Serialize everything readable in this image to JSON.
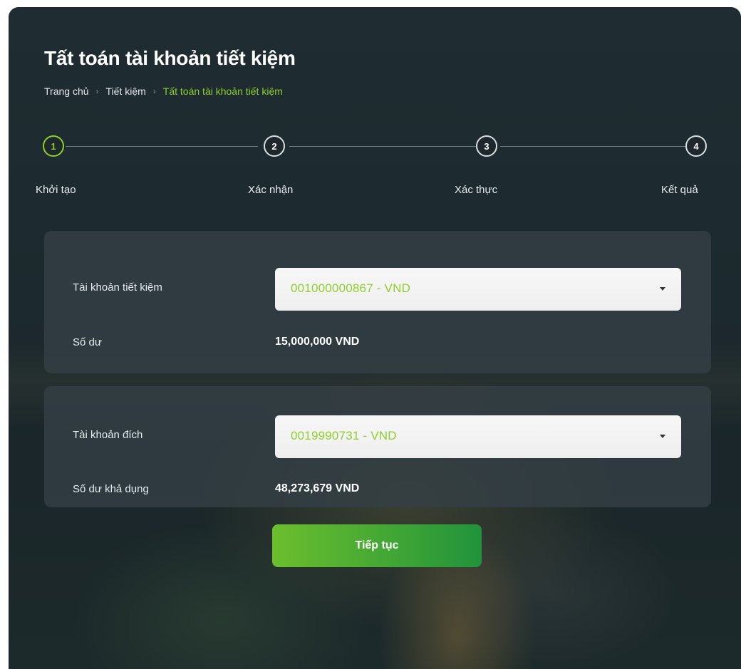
{
  "page": {
    "title": "Tất toán tài khoản tiết kiệm"
  },
  "breadcrumb": {
    "items": [
      "Trang chủ",
      "Tiết kiệm",
      "Tất toán tài khoản tiết kiệm"
    ],
    "separator": "›"
  },
  "stepper": {
    "steps": [
      {
        "number": "1",
        "label": "Khởi tạo",
        "active": true
      },
      {
        "number": "2",
        "label": "Xác nhận",
        "active": false
      },
      {
        "number": "3",
        "label": "Xác thực",
        "active": false
      },
      {
        "number": "4",
        "label": "Kết quả",
        "active": false
      }
    ]
  },
  "source_panel": {
    "account_label": "Tài khoản tiết kiệm",
    "account_value": "001000000867 - VND",
    "balance_label": "Số dư",
    "balance_value": "15,000,000 VND"
  },
  "target_panel": {
    "account_label": "Tài khoản đích",
    "account_value": "0019990731 - VND",
    "balance_label": "Số dư khả dụng",
    "balance_value": "48,273,679 VND"
  },
  "actions": {
    "continue_label": "Tiếp tục"
  },
  "colors": {
    "accent": "#8fcf2a",
    "button_start": "#6cbe2d",
    "button_end": "#21933c",
    "background": "#1f2d32"
  },
  "icons": {
    "dropdown": "caret-down-icon",
    "separator": "chevron-right-icon"
  }
}
